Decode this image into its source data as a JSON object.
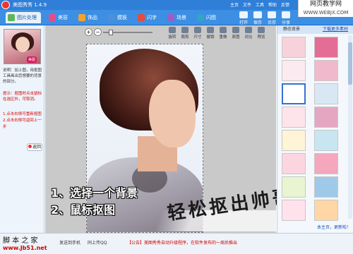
{
  "app": {
    "title": "美图秀秀 1.4.9"
  },
  "menu": [
    "主页",
    "文件",
    "工具",
    "帮助",
    "反馈"
  ],
  "watermark": {
    "name": "网页教学网",
    "url": "WWW.WEBJX.COM"
  },
  "tabs": [
    {
      "label": "图片处理",
      "color": "#5fb65a"
    },
    {
      "label": "美容",
      "color": "#e44d8a"
    },
    {
      "label": "饰品",
      "color": "#f2a32c"
    },
    {
      "label": "模板",
      "color": "#4e8fd9"
    },
    {
      "label": "闪字",
      "color": "#e84b3c"
    },
    {
      "label": "场景",
      "color": "#9b5ec4"
    },
    {
      "label": "闪图",
      "color": "#33a3c8"
    }
  ],
  "toolbar_right": [
    "打开",
    "保存",
    "另存",
    "分享"
  ],
  "edit_tools": [
    "旋转",
    "裁剪",
    "尺寸",
    "撤销",
    "重做",
    "原图",
    "对比",
    "预览"
  ],
  "left_panel": {
    "intro": "说明：加上图，用抠图工具画出您想要的背景的部分。",
    "tip": "提示：抠图时点击鼠标在选区外，可取消。",
    "steps": [
      "1.点击右侧可重新抠图",
      "2.点击右侧可返回上一步"
    ],
    "back_button": "返回"
  },
  "canvas": {
    "overlay_steps": [
      "1、选择一个背景",
      "2、鼠标抠图"
    ],
    "slogan": "轻松抠出帅哥"
  },
  "right_panel": {
    "category": "静态背景",
    "more": "下载更多素材",
    "thumb_colors": [
      "#f7d2da",
      "#e46d95",
      "#fbeaf0",
      "#f0b9cc",
      "#ffffff",
      "#d9e7f5",
      "#fce4ea",
      "#e5a6c1",
      "#fff4d6",
      "#c8e6f2",
      "#fbd5e0",
      "#f4a7bd",
      "#e8f5d0",
      "#9fc9e8",
      "#ffe2ec",
      "#ffd6a5"
    ],
    "footer": "本主页，更新啦！"
  },
  "statusbar": {
    "site_name": "脚 本 之 家",
    "site_url": "www.Jb51.net",
    "left_item": "发送到手机",
    "mid_item": "同上传QQ",
    "notice": "【公告】美图秀秀自动升级程序，在软件发布的一周后推出"
  }
}
